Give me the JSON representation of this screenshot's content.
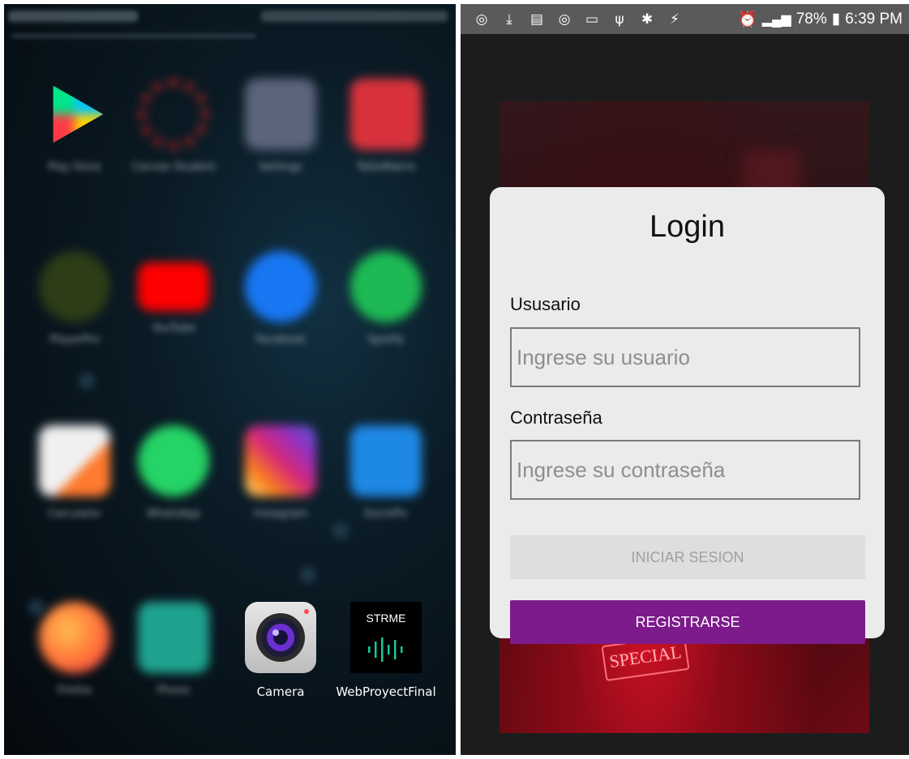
{
  "left_screen": {
    "apps": [
      {
        "name": "Play Store",
        "icon": "play-store-icon",
        "color": "#3a8bd6",
        "blurred": true
      },
      {
        "name": "Canvas Student",
        "icon": "canvas-icon",
        "color": "#c0241e",
        "blurred": true
      },
      {
        "name": "Settings",
        "icon": "gear-icon",
        "color": "#5b647b",
        "blurred": true
      },
      {
        "name": "ToDoMatrix",
        "icon": "todo-icon",
        "color": "#d9323c",
        "blurred": true
      },
      {
        "name": "PlayerPro",
        "icon": "playerpro-icon",
        "color": "#3d5a1c",
        "blurred": true
      },
      {
        "name": "YouTube",
        "icon": "youtube-icon",
        "color": "#ff0000",
        "blurred": true
      },
      {
        "name": "Facebook",
        "icon": "facebook-icon",
        "color": "#1877f2",
        "blurred": true
      },
      {
        "name": "Spotify",
        "icon": "spotify-icon",
        "color": "#1db954",
        "blurred": true
      },
      {
        "name": "Calculator",
        "icon": "calculator-icon",
        "color": "#e8e8e8",
        "blurred": true
      },
      {
        "name": "WhatsApp",
        "icon": "whatsapp-icon",
        "color": "#25d366",
        "blurred": true
      },
      {
        "name": "Instagram",
        "icon": "instagram-icon",
        "color": "#c13584",
        "blurred": true
      },
      {
        "name": "QuickPic",
        "icon": "quickpic-icon",
        "color": "#1e88e5",
        "blurred": true
      },
      {
        "name": "Firefox",
        "icon": "firefox-icon",
        "color": "#ff7139",
        "blurred": true
      },
      {
        "name": "Phone",
        "icon": "phone-icon",
        "color": "#1fa38f",
        "blurred": true
      },
      {
        "name": "Camera",
        "icon": "camera-icon",
        "color": "#d7d7d7",
        "blurred": false
      },
      {
        "name": "WebProyectFinal",
        "icon": "strme-icon",
        "color": "#000000",
        "blurred": false
      }
    ],
    "strme_text": "STRME"
  },
  "statusbar": {
    "battery": "78%",
    "time": "6:39 PM"
  },
  "login": {
    "title": "Login",
    "user_label": "Ususario",
    "user_placeholder": "Ingrese su usuario",
    "pass_label": "Contraseña",
    "pass_placeholder": "Ingrese su contraseña",
    "login_button": "INICIAR SESION",
    "register_button": "REGISTRARSE",
    "accent": "#7d1a8c",
    "sign_text": "SPECIAL"
  }
}
